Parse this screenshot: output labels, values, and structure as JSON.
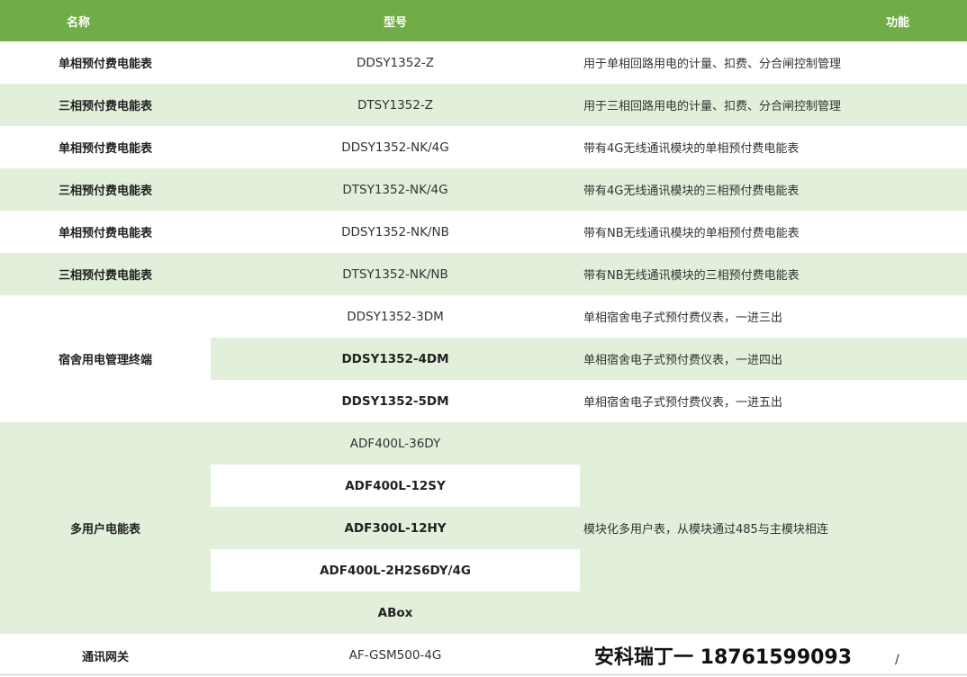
{
  "header": {
    "name": "名称",
    "model": "型号",
    "function": "功能"
  },
  "rows": [
    {
      "name": "单相预付费电能表",
      "model": "DDSY1352-Z",
      "function": "用于单相回路用电的计量、扣费、分合闸控制管理"
    },
    {
      "name": "三相预付费电能表",
      "model": "DTSY1352-Z",
      "function": "用于三相回路用电的计量、扣费、分合闸控制管理"
    },
    {
      "name": "单相预付费电能表",
      "model": "DDSY1352-NK/4G",
      "function": "带有4G无线通讯模块的单相预付费电能表"
    },
    {
      "name": "三相预付费电能表",
      "model": "DTSY1352-NK/4G",
      "function": "带有4G无线通讯模块的三相预付费电能表"
    },
    {
      "name": "单相预付费电能表",
      "model": "DDSY1352-NK/NB",
      "function": "带有NB无线通讯模块的单相预付费电能表"
    },
    {
      "name": "三相预付费电能表",
      "model": "DTSY1352-NK/NB",
      "function": "带有NB无线通讯模块的三相预付费电能表"
    }
  ],
  "dorm": {
    "name": "宿舍用电管理终端",
    "items": [
      {
        "model": "DDSY1352-3DM",
        "function": "单相宿舍电子式预付费仪表，一进三出"
      },
      {
        "model": "DDSY1352-4DM",
        "function": "单相宿舍电子式预付费仪表，一进四出"
      },
      {
        "model": "DDSY1352-5DM",
        "function": "单相宿舍电子式预付费仪表，一进五出"
      }
    ]
  },
  "multi": {
    "name": "多用户电能表",
    "models": [
      "ADF400L-36DY",
      "ADF400L-12SY",
      "ADF300L-12HY",
      "ADF400L-2H2S6DY/4G",
      "ABox"
    ],
    "function": "模块化多用户表，从模块通过485与主模块相连"
  },
  "gateway": {
    "name": "通讯网关",
    "model": "AF-GSM500-4G",
    "contact": "安科瑞丁一 18761599093",
    "function": "/"
  },
  "colors": {
    "header_bg": "#70ad47",
    "stripe_bg": "#e2efda"
  }
}
